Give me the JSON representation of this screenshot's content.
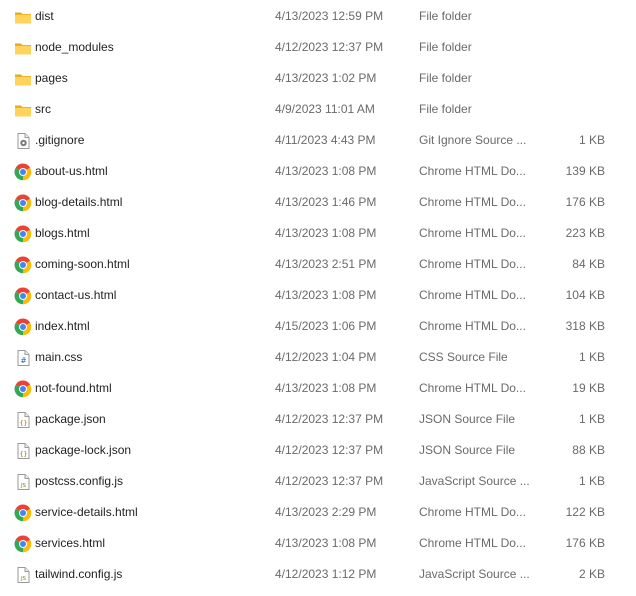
{
  "rows": [
    {
      "name": "dist",
      "date": "4/13/2023 12:59 PM",
      "type": "File folder",
      "size": "",
      "icon": "folder-icon"
    },
    {
      "name": "node_modules",
      "date": "4/12/2023 12:37 PM",
      "type": "File folder",
      "size": "",
      "icon": "folder-icon"
    },
    {
      "name": "pages",
      "date": "4/13/2023 1:02 PM",
      "type": "File folder",
      "size": "",
      "icon": "folder-icon"
    },
    {
      "name": "src",
      "date": "4/9/2023 11:01 AM",
      "type": "File folder",
      "size": "",
      "icon": "folder-icon"
    },
    {
      "name": ".gitignore",
      "date": "4/11/2023 4:43 PM",
      "type": "Git Ignore Source ...",
      "size": "1 KB",
      "icon": "gear-file-icon"
    },
    {
      "name": "about-us.html",
      "date": "4/13/2023 1:08 PM",
      "type": "Chrome HTML Do...",
      "size": "139 KB",
      "icon": "chrome-icon"
    },
    {
      "name": "blog-details.html",
      "date": "4/13/2023 1:46 PM",
      "type": "Chrome HTML Do...",
      "size": "176 KB",
      "icon": "chrome-icon"
    },
    {
      "name": "blogs.html",
      "date": "4/13/2023 1:08 PM",
      "type": "Chrome HTML Do...",
      "size": "223 KB",
      "icon": "chrome-icon"
    },
    {
      "name": "coming-soon.html",
      "date": "4/13/2023 2:51 PM",
      "type": "Chrome HTML Do...",
      "size": "84 KB",
      "icon": "chrome-icon"
    },
    {
      "name": "contact-us.html",
      "date": "4/13/2023 1:08 PM",
      "type": "Chrome HTML Do...",
      "size": "104 KB",
      "icon": "chrome-icon"
    },
    {
      "name": "index.html",
      "date": "4/15/2023 1:06 PM",
      "type": "Chrome HTML Do...",
      "size": "318 KB",
      "icon": "chrome-icon"
    },
    {
      "name": "main.css",
      "date": "4/12/2023 1:04 PM",
      "type": "CSS Source File",
      "size": "1 KB",
      "icon": "css-file-icon"
    },
    {
      "name": "not-found.html",
      "date": "4/13/2023 1:08 PM",
      "type": "Chrome HTML Do...",
      "size": "19 KB",
      "icon": "chrome-icon"
    },
    {
      "name": "package.json",
      "date": "4/12/2023 12:37 PM",
      "type": "JSON Source File",
      "size": "1 KB",
      "icon": "json-file-icon"
    },
    {
      "name": "package-lock.json",
      "date": "4/12/2023 12:37 PM",
      "type": "JSON Source File",
      "size": "88 KB",
      "icon": "json-file-icon"
    },
    {
      "name": "postcss.config.js",
      "date": "4/12/2023 12:37 PM",
      "type": "JavaScript Source ...",
      "size": "1 KB",
      "icon": "js-file-icon"
    },
    {
      "name": "service-details.html",
      "date": "4/13/2023 2:29 PM",
      "type": "Chrome HTML Do...",
      "size": "122 KB",
      "icon": "chrome-icon"
    },
    {
      "name": "services.html",
      "date": "4/13/2023 1:08 PM",
      "type": "Chrome HTML Do...",
      "size": "176 KB",
      "icon": "chrome-icon"
    },
    {
      "name": "tailwind.config.js",
      "date": "4/12/2023 1:12 PM",
      "type": "JavaScript Source ...",
      "size": "2 KB",
      "icon": "js-file-icon"
    }
  ]
}
